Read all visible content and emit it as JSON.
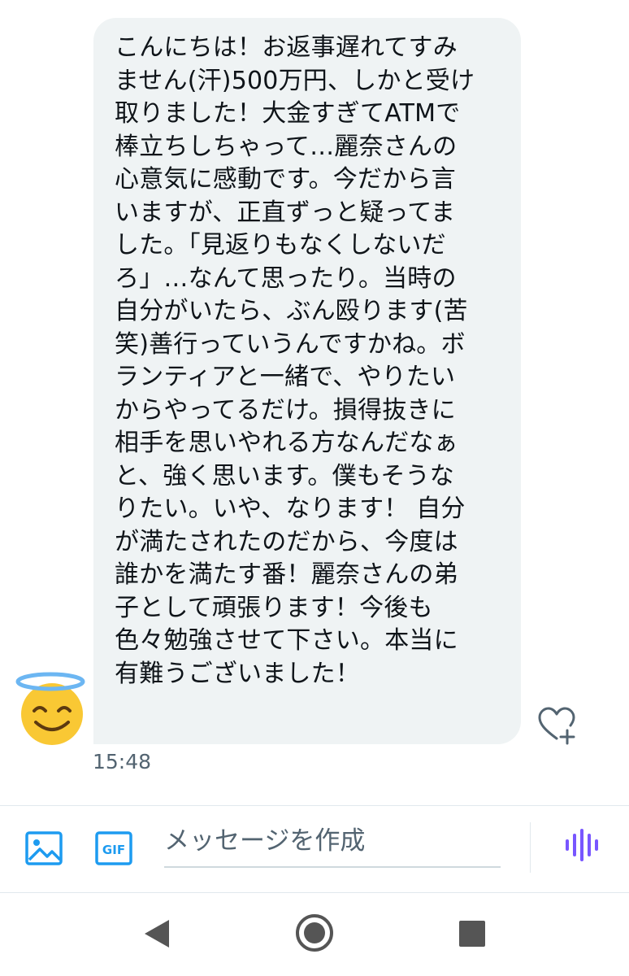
{
  "message": {
    "lines": [
      "こんにちは！お返事遅れてすみ",
      "ません(汗)500万円、しかと受け",
      "取りました！大金すぎてATMで",
      "棒立ちしちゃって…麗奈さんの",
      "心意気に感動です。今だから言",
      "いますが、正直ずっと疑ってま",
      "した。「見返りもなくしないだ",
      "ろ」…なんて思ったり。当時の",
      "自分がいたら、ぶん殴ります(苦",
      "笑)善行っていうんですかね。ボ",
      "ランティアと一緒で、やりたい",
      "からやってるだけ。損得抜きに",
      "相手を思いやれる方なんだなぁ",
      "と、強く思います。僕もそうな",
      "りたい。いや、なります！ 自分",
      "が満たされたのだから、今度は",
      "誰かを満たす番！麗奈さんの弟",
      "子として頑張ります！今後も",
      "色々勉強させて下さい。本当に",
      "有難うございました！"
    ],
    "timestamp": "15:48",
    "sender_avatar_icon": "smiling-face-with-halo-icon",
    "like_icon": "heart-plus-icon"
  },
  "composer": {
    "placeholder": "メッセージを作成",
    "image_icon": "image-icon",
    "gif_label": "GIF",
    "voice_icon": "voice-waveform-icon"
  },
  "navbar": {
    "back_icon": "back-triangle-icon",
    "home_icon": "home-circle-icon",
    "recents_icon": "recents-square-icon"
  },
  "colors": {
    "accent": "#1d9bf0",
    "voice": "#7856ff",
    "bubble": "#eff3f4",
    "text": "#0f1419",
    "secondary_text": "#536471"
  }
}
